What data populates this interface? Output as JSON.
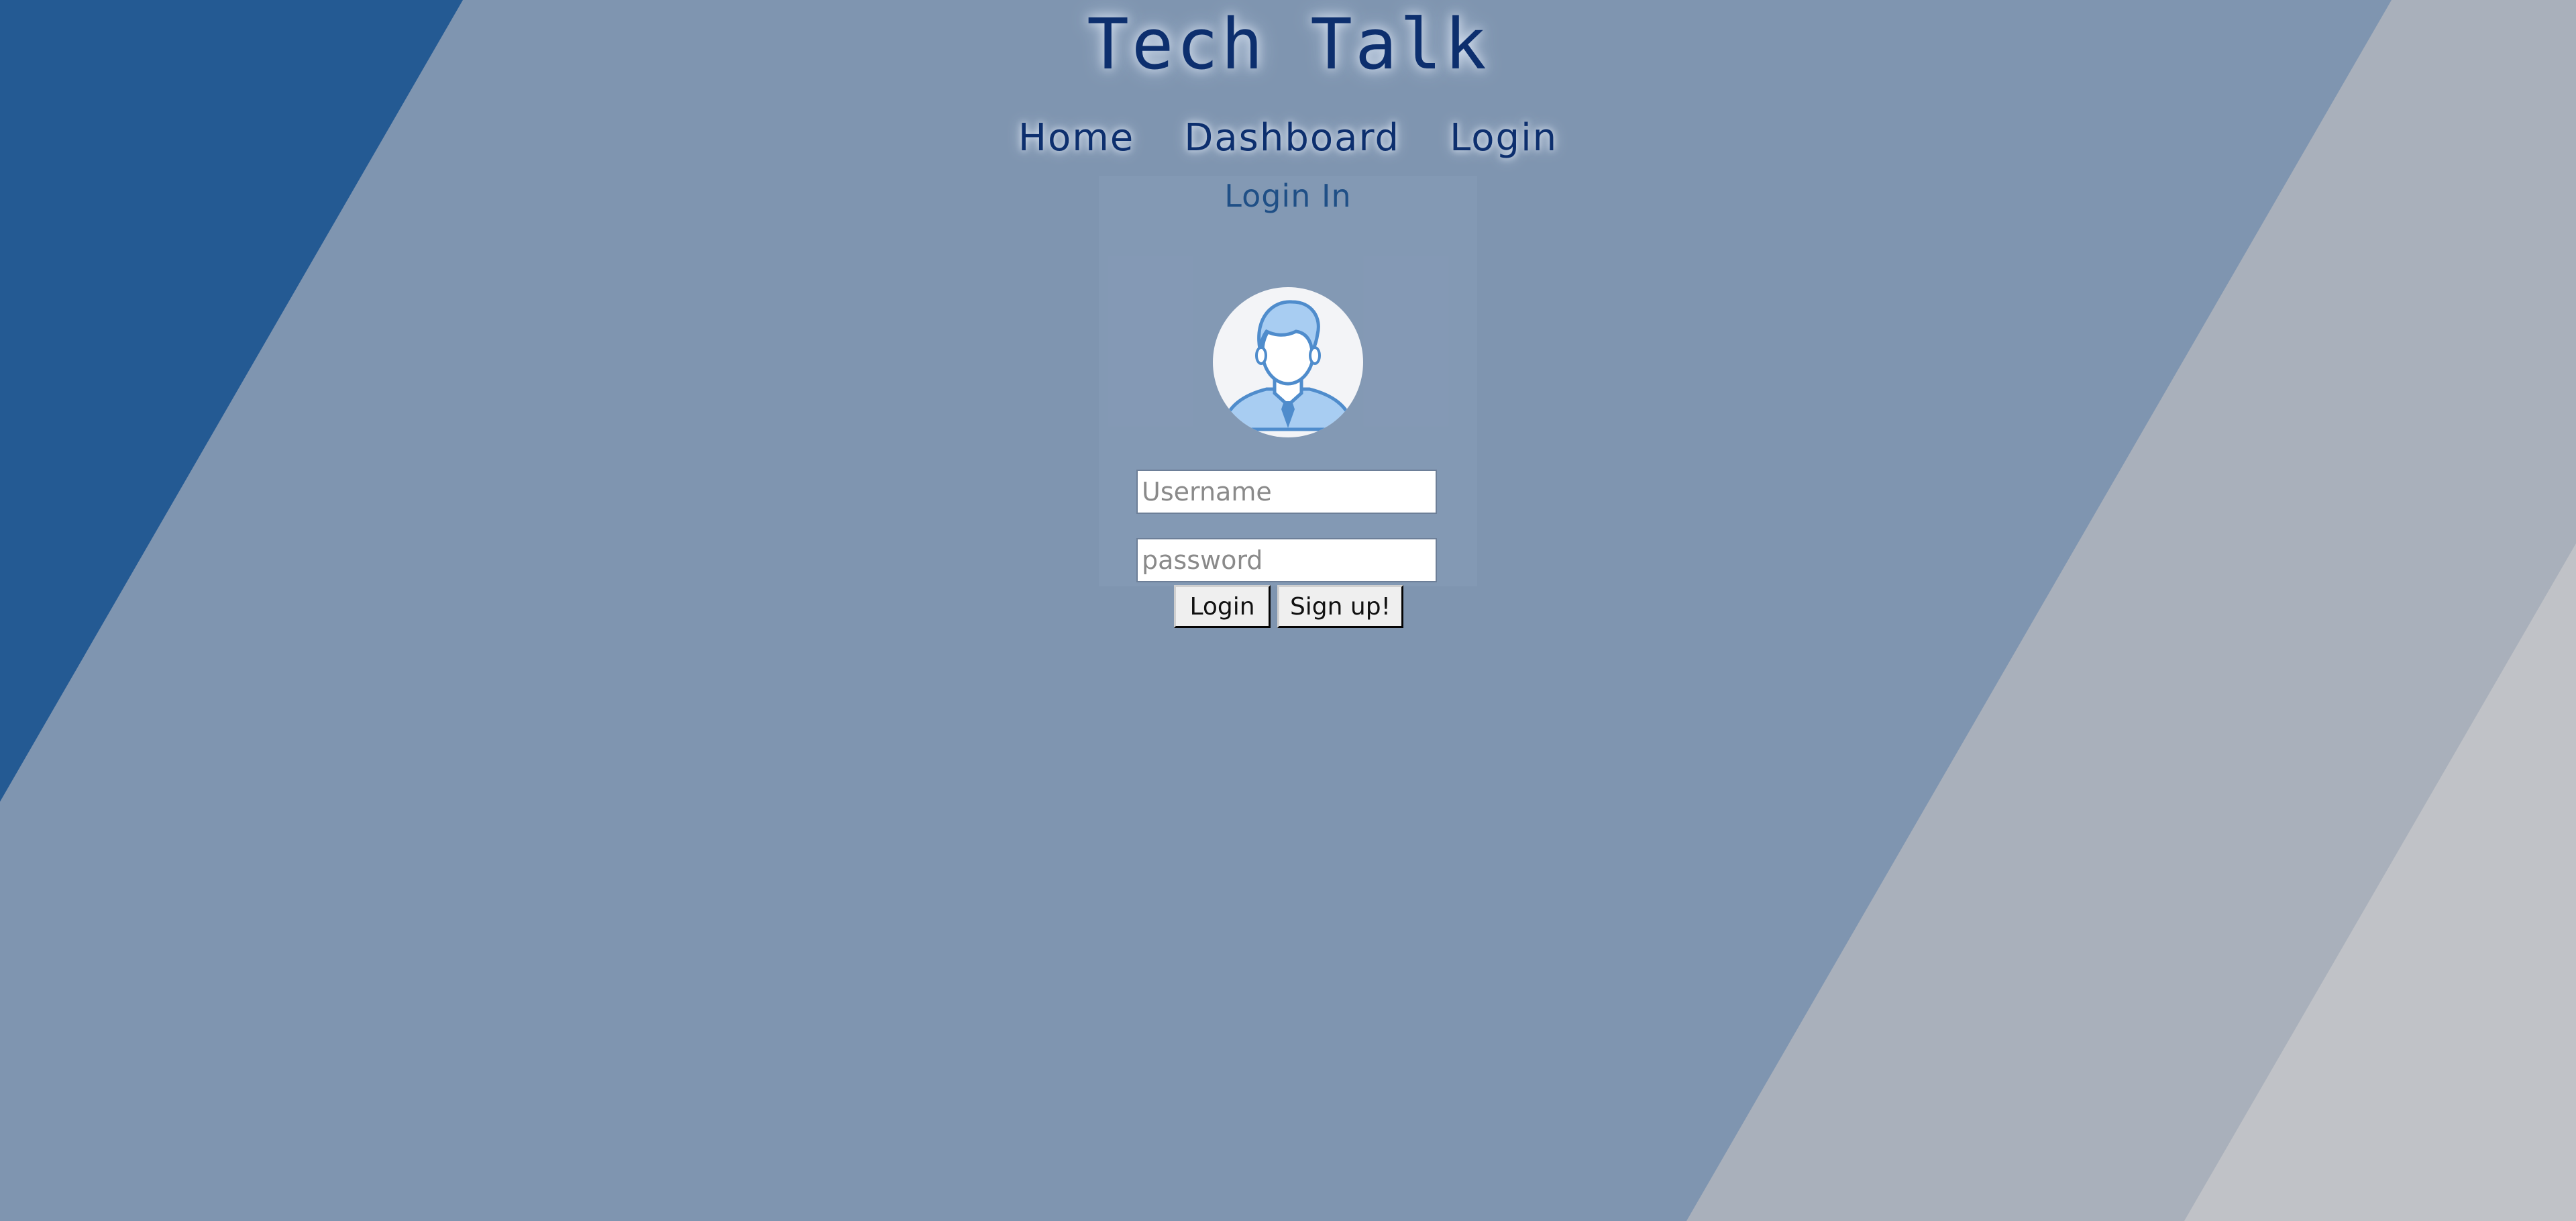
{
  "header": {
    "title": "Tech Talk"
  },
  "nav": {
    "items": [
      {
        "label": "Home"
      },
      {
        "label": "Dashboard"
      },
      {
        "label": "Login"
      }
    ]
  },
  "login_form": {
    "heading": "Login In",
    "avatar_icon": "user-avatar-icon",
    "username_placeholder": "Username",
    "password_placeholder": "password",
    "login_button": "Login",
    "signup_button": "Sign up!"
  },
  "colors": {
    "page_background": "#7f95b0",
    "dark_stripe": "#245a93",
    "light_stripe": "#a9b0bb",
    "lighter_stripe": "#c0c2c7",
    "title_text": "#0d2f6e",
    "heading_text": "#1f4f86",
    "avatar_accent": "#7fb0e6"
  }
}
